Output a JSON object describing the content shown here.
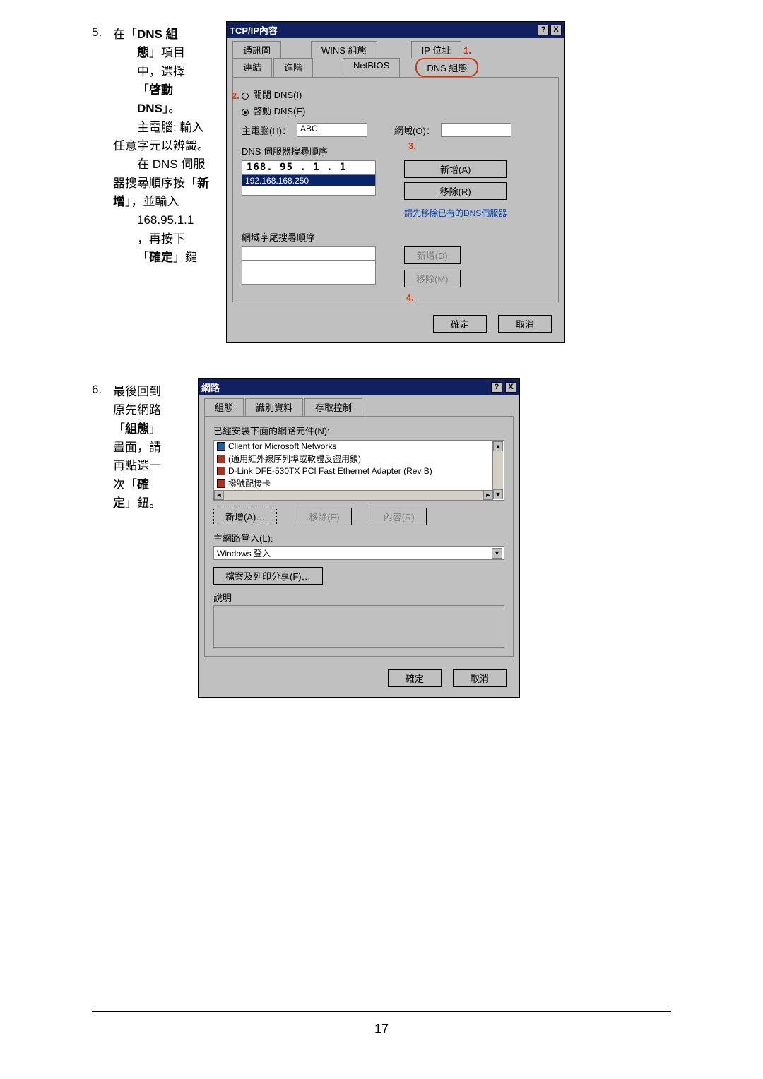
{
  "page_number": "17",
  "step5": {
    "number": "5.",
    "text_parts": {
      "l1a": "在「",
      "l1b": "DNS 組",
      "l2a": "態",
      "l2b": "」項目",
      "l3": "中，選擇",
      "l4a": "「",
      "l4b": "啓動",
      "l5a": "DNS",
      "l5b": "」。",
      "l6": "主電腦: 輸入",
      "l7": "任意字元以辨識。",
      "l8": "在 DNS 伺服",
      "l9a": "器搜尋順序按「",
      "l9b": "新",
      "l10a": "增",
      "l10b": "」，並輸入",
      "l11": "168.95.1.1",
      "l12": "，再按下",
      "l13a": "「",
      "l13b": "確定",
      "l13c": "」鍵"
    },
    "dialog": {
      "title": "TCP/IP內容",
      "titlebar_buttons": {
        "help": "?",
        "close": "X"
      },
      "tabs_row1": {
        "gateway": "通訊閘",
        "wins": "WINS 組態",
        "ip": "IP 位址"
      },
      "tabs_row2": {
        "bindings": "連結",
        "advanced": "進階",
        "netbios": "NetBIOS",
        "dns": "DNS 組態"
      },
      "radio_off": "關閉 DNS(I)",
      "radio_on": "啓動 DNS(E)",
      "host_lbl": "主電腦(H)：",
      "host_val": "ABC",
      "domain_lbl": "網域(O)：",
      "domain_val": "",
      "dns_order_lbl": "DNS 伺服器搜尋順序",
      "dns_entry": "168. 95 .  1  .  1",
      "dns_list_selected": "192.168.168.250",
      "btn_add": "新增(A)",
      "btn_remove": "移除(R)",
      "note_remove_existing": "請先移除已有的DNS伺服器",
      "suffix_lbl": "網域字尾搜尋順序",
      "suffix_add": "新增(D)",
      "suffix_remove": "移除(M)",
      "ok": "確定",
      "cancel": "取消",
      "ann": {
        "n1": "1.",
        "n2": "2.",
        "n3": "3.",
        "n4": "4."
      }
    }
  },
  "step6": {
    "number": "6.",
    "text_parts": {
      "l1": "最後回到",
      "l2": "原先網路",
      "l3a": "「",
      "l3b": "組態",
      "l3c": "」",
      "l4": "畫面，請",
      "l5": "再點選一",
      "l6a": "次「",
      "l6b": "確",
      "l7a": "定",
      "l7b": "」鈕。"
    },
    "dialog": {
      "title": "網路",
      "titlebar_buttons": {
        "help": "?",
        "close": "X"
      },
      "tab_config": "組態",
      "tab_id": "識別資料",
      "tab_access": "存取控制",
      "installed_lbl": "已經安裝下面的網路元件(N):",
      "items": [
        "Client for Microsoft Networks",
        "(通用紅外線序列埠或軟體反盜用鎖)",
        "D-Link DFE-530TX PCI Fast Ethernet Adapter (Rev B)",
        "撥號配接卡"
      ],
      "btn_add": "新增(A)…",
      "btn_remove": "移除(E)",
      "btn_props": "內容(R)",
      "primary_logon_lbl": "主網路登入(L):",
      "primary_logon_val": "Windows 登入",
      "file_print_btn": "檔案及列印分享(F)…",
      "desc_lbl": "說明",
      "ok": "確定",
      "cancel": "取消"
    }
  }
}
